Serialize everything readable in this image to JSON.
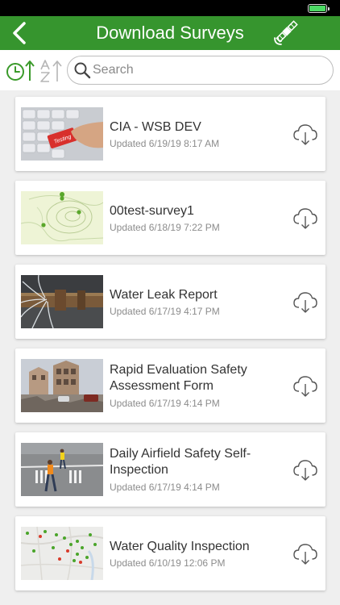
{
  "nav": {
    "title": "Download Surveys"
  },
  "search": {
    "placeholder": "Search",
    "value": ""
  },
  "colors": {
    "nav_green": "#36952e",
    "accent_green": "#3a9a2a",
    "battery": "#4cd964"
  },
  "icons": {
    "back": "chevron-left-icon",
    "satellite": "satellite-icon",
    "sort_time": "clock-sort-icon",
    "sort_alpha": "alpha-sort-icon",
    "search": "search-icon",
    "download": "cloud-download-icon"
  },
  "surveys": [
    {
      "title": "CIA - WSB DEV",
      "updated": "Updated 6/19/19 8:17 AM",
      "thumbnail": "keyboard-testing-key"
    },
    {
      "title": "00test-survey1",
      "updated": "Updated 6/18/19 7:22 PM",
      "thumbnail": "topographic-map"
    },
    {
      "title": "Water Leak Report",
      "updated": "Updated 6/17/19 4:17 PM",
      "thumbnail": "leaking-pipe"
    },
    {
      "title": "Rapid Evaluation Safety Assessment Form",
      "updated": "Updated 6/17/19 4:14 PM",
      "thumbnail": "damaged-building"
    },
    {
      "title": "Daily Airfield Safety Self-Inspection",
      "updated": "Updated 6/17/19 4:14 PM",
      "thumbnail": "airfield-workers"
    },
    {
      "title": "Water Quality Inspection",
      "updated": "Updated 6/10/19 12:06 PM",
      "thumbnail": "points-map"
    }
  ]
}
